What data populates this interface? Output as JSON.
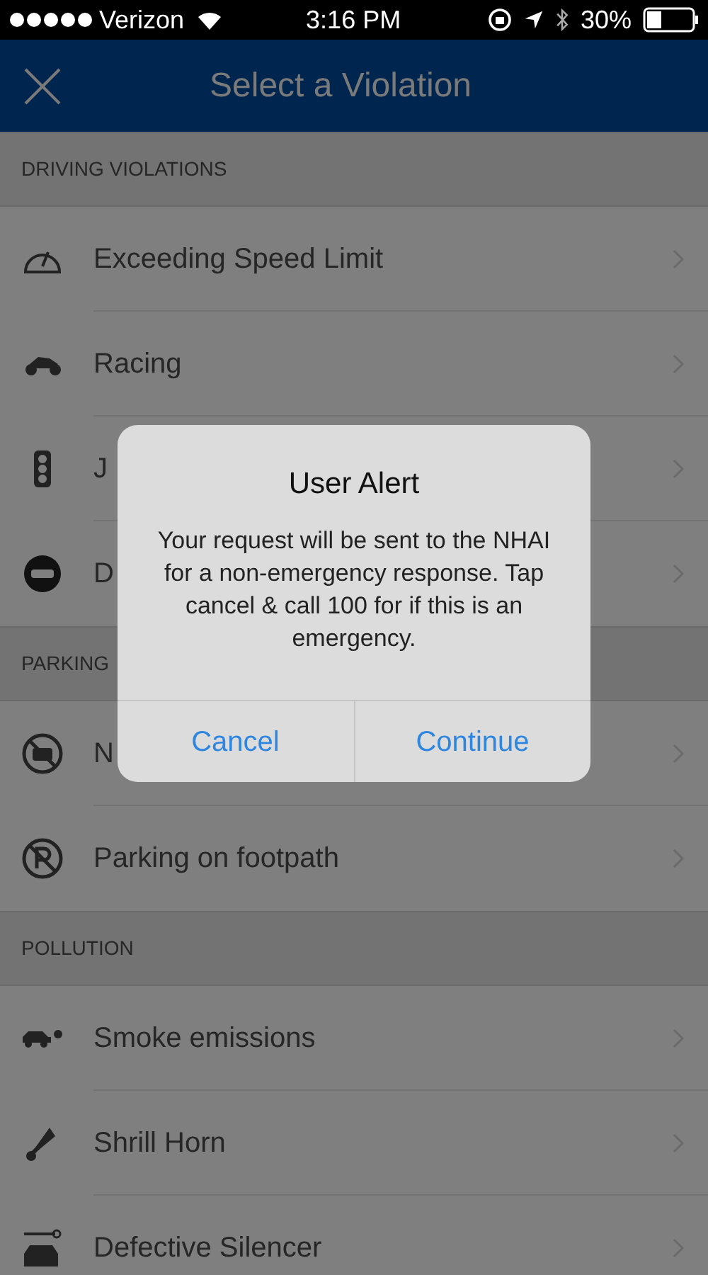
{
  "status_bar": {
    "carrier": "Verizon",
    "time": "3:16 PM",
    "battery": "30%"
  },
  "nav_bar": {
    "title": "Select a Violation"
  },
  "sections": [
    {
      "title": "DRIVING VIOLATIONS",
      "items": [
        {
          "label": "Exceeding Speed Limit"
        },
        {
          "label": "Racing"
        },
        {
          "label": "J"
        },
        {
          "label": "D"
        }
      ]
    },
    {
      "title": "PARKING",
      "items": [
        {
          "label": "N"
        },
        {
          "label": "Parking on footpath"
        }
      ]
    },
    {
      "title": "POLLUTION",
      "items": [
        {
          "label": "Smoke emissions"
        },
        {
          "label": "Shrill Horn"
        },
        {
          "label": "Defective Silencer"
        }
      ]
    }
  ],
  "alert": {
    "title": "User Alert",
    "message": "Your request will be sent to the NHAI for a non-emergency response. Tap cancel & call 100 for if this is an emergency.",
    "buttons": [
      "Cancel",
      "Continue"
    ]
  }
}
